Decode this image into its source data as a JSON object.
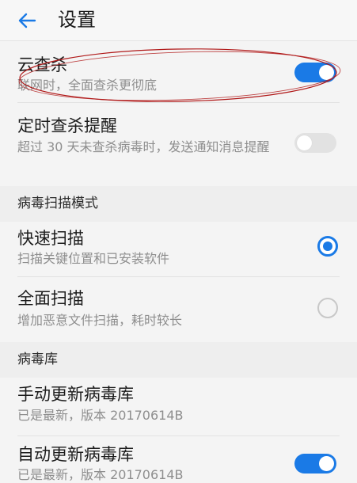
{
  "header": {
    "title": "设置"
  },
  "items": [
    {
      "title": "云查杀",
      "subtitle": "联网时，全面查杀更彻底",
      "control": "switch",
      "state": "on"
    },
    {
      "title": "定时查杀提醒",
      "subtitle": "超过 30 天未查杀病毒时，发送通知消息提醒",
      "control": "switch",
      "state": "off"
    }
  ],
  "scan_section": {
    "label": "病毒扫描模式",
    "options": [
      {
        "title": "快速扫描",
        "subtitle": "扫描关键位置和已安装软件",
        "selected": true
      },
      {
        "title": "全面扫描",
        "subtitle": "增加恶意文件扫描，耗时较长",
        "selected": false
      }
    ]
  },
  "db_section": {
    "label": "病毒库",
    "items": [
      {
        "title": "手动更新病毒库",
        "subtitle": "已是最新，版本 20170614B"
      },
      {
        "title": "自动更新病毒库",
        "subtitle": "已是最新，版本 20170614B",
        "control": "switch",
        "state": "on"
      }
    ]
  },
  "colors": {
    "accent": "#1a7ae6",
    "annotation": "#b01818"
  }
}
